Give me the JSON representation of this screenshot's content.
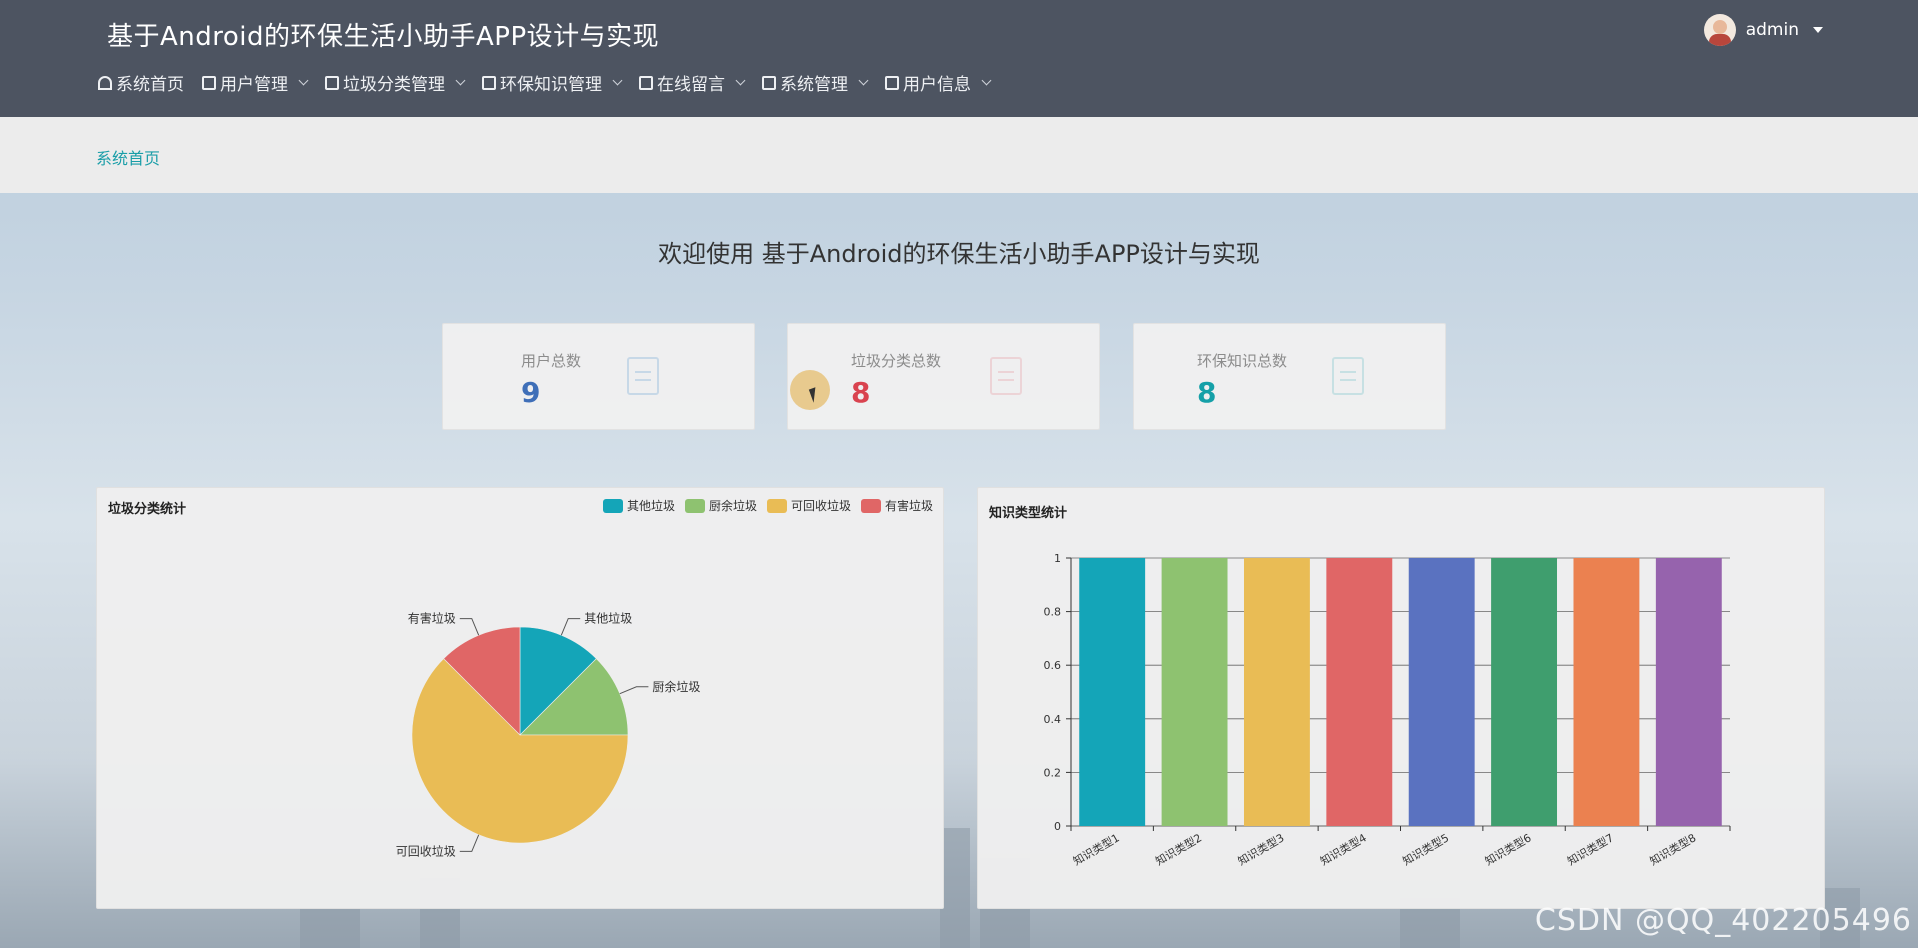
{
  "header": {
    "app_title": "基于Android的环保生活小助手APP设计与实现",
    "user_name": "admin"
  },
  "nav": [
    {
      "label": "系统首页",
      "icon": "home-icon",
      "has_dropdown": false
    },
    {
      "label": "用户管理",
      "icon": "clipboard-check-icon",
      "has_dropdown": true
    },
    {
      "label": "垃圾分类管理",
      "icon": "briefcase-icon",
      "has_dropdown": true
    },
    {
      "label": "环保知识管理",
      "icon": "clipboard-icon",
      "has_dropdown": true
    },
    {
      "label": "在线留言",
      "icon": "grid-icon",
      "has_dropdown": true
    },
    {
      "label": "系统管理",
      "icon": "marker-icon",
      "has_dropdown": true
    },
    {
      "label": "用户信息",
      "icon": "id-card-icon",
      "has_dropdown": true
    }
  ],
  "breadcrumb": "系统首页",
  "welcome": "欢迎使用 基于Android的环保生活小助手APP设计与实现",
  "stats": [
    {
      "label": "用户总数",
      "value": "9",
      "color": "#3f6fb8",
      "icon_color": "#7eb0d8"
    },
    {
      "label": "垃圾分类总数",
      "value": "8",
      "color": "#d9434f",
      "icon_color": "#e9a2a8"
    },
    {
      "label": "环保知识总数",
      "value": "8",
      "color": "#15a0a8",
      "icon_color": "#7fc6cc"
    }
  ],
  "pie_panel": {
    "title": "垃圾分类统计"
  },
  "bar_panel": {
    "title": "知识类型统计"
  },
  "chart_data": [
    {
      "type": "pie",
      "title": "垃圾分类统计",
      "legend_position": "top-right",
      "slices": [
        {
          "name": "其他垃圾",
          "value": 1,
          "color": "#14a5b8"
        },
        {
          "name": "厨余垃圾",
          "value": 1,
          "color": "#8ec270"
        },
        {
          "name": "可回收垃圾",
          "value": 5,
          "color": "#e9bc55"
        },
        {
          "name": "有害垃圾",
          "value": 1,
          "color": "#e06666"
        }
      ]
    },
    {
      "type": "bar",
      "title": "知识类型统计",
      "categories": [
        "知识类型1",
        "知识类型2",
        "知识类型3",
        "知识类型4",
        "知识类型5",
        "知识类型6",
        "知识类型7",
        "知识类型8"
      ],
      "values": [
        1,
        1,
        1,
        1,
        1,
        1,
        1,
        1
      ],
      "colors": [
        "#14a5b8",
        "#8ec270",
        "#e9bc55",
        "#e06666",
        "#5a72c0",
        "#3f9e6e",
        "#eb8150",
        "#9663ad"
      ],
      "ylim": [
        0,
        1
      ],
      "yticks": [
        "0",
        "0.2",
        "0.4",
        "0.6",
        "0.8",
        "1"
      ],
      "grid": true
    }
  ],
  "watermark": "CSDN @QQ_402205496"
}
